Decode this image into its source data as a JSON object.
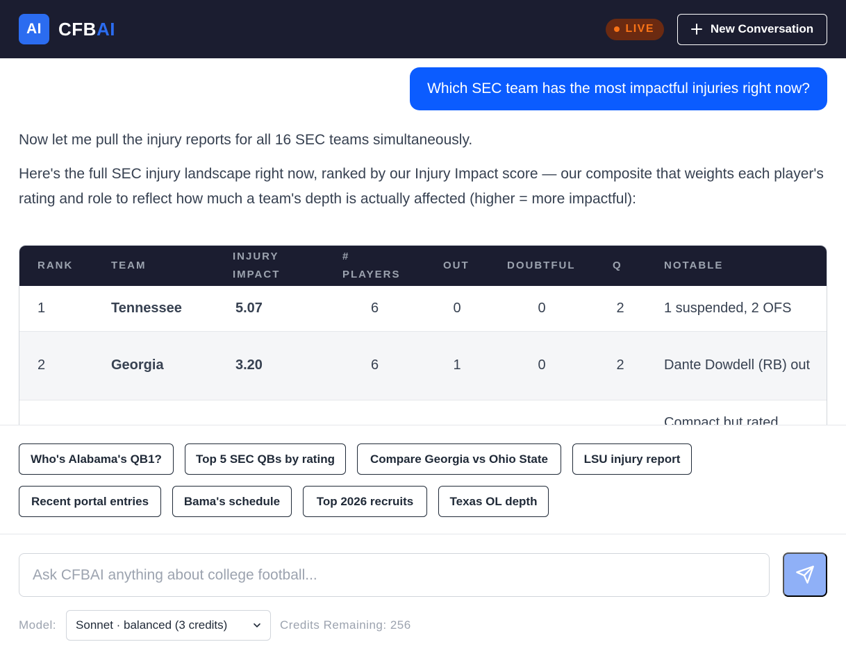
{
  "header": {
    "logo_text": "AI",
    "brand_main": "CFB",
    "brand_accent": "AI",
    "live_label": "LIVE",
    "new_conversation_label": "New Conversation"
  },
  "chat": {
    "user_message": "Which SEC team has the most impactful injuries right now?",
    "assistant_intro": "Now let me pull the injury reports for all 16 SEC teams simultaneously.",
    "assistant_detail": "Here's the full SEC injury landscape right now, ranked by our Injury Impact score — our composite that weights each player's rating and role to reflect how much a team's depth is actually affected (higher = more impactful):"
  },
  "injury_table": {
    "headers": {
      "rank": "RANK",
      "team": "TEAM",
      "impact_l1": "INJURY",
      "impact_l2": "IMPACT",
      "players_l1": "#",
      "players_l2": "PLAYERS",
      "out": "OUT",
      "doubtful": "DOUBTFUL",
      "q": "Q",
      "notable": "NOTABLE"
    },
    "rows": [
      {
        "rank": "1",
        "team": "Tennessee",
        "impact": "5.07",
        "players": "6",
        "out": "0",
        "doubtful": "0",
        "q": "2",
        "notable": "1 suspended, 2 OFS"
      },
      {
        "rank": "2",
        "team": "Georgia",
        "impact": "3.20",
        "players": "6",
        "out": "1",
        "doubtful": "0",
        "q": "2",
        "notable": "Dante Dowdell (RB) out"
      },
      {
        "rank": "",
        "team": "",
        "impact": "",
        "players": "",
        "out": "",
        "doubtful": "",
        "q": "",
        "notable": "Compact but rated"
      }
    ]
  },
  "suggestions": [
    "Who's Alabama's QB1?",
    "Top 5 SEC QBs by rating",
    "Compare Georgia vs Ohio State",
    "LSU injury report",
    "Recent portal entries",
    "Bama's schedule",
    "Top 2026 recruits",
    "Texas OL depth"
  ],
  "composer": {
    "placeholder": "Ask CFBAI anything about college football...",
    "model_label": "Model:",
    "model_selected": "Sonnet · balanced (3 credits)",
    "credits_text": "Credits Remaining: 256"
  },
  "colors": {
    "header_bg": "#1b1d30",
    "brand_blue": "#2b6cf0",
    "user_bubble": "#0b5cff",
    "live_orange": "#f97316",
    "send_button": "#8fb0f7"
  },
  "icons": {
    "plus": "plus-icon",
    "dot": "live-dot-icon",
    "send": "send-icon",
    "chevron": "chevron-down-icon"
  }
}
